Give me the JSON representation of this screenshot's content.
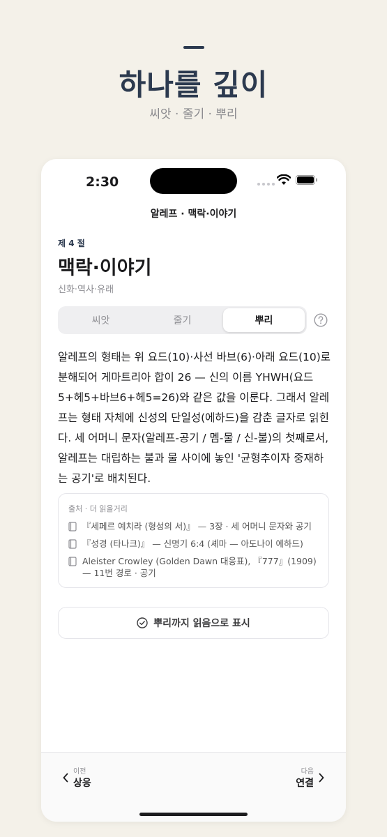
{
  "hero": {
    "title": "하나를 깊이",
    "subtitle": "씨앗 · 줄기 · 뿌리"
  },
  "status_bar": {
    "time": "2:30",
    "icons": [
      "signal-dots-icon",
      "wifi-icon",
      "battery-icon"
    ]
  },
  "nav": {
    "title": "알레프 · 맥락·이야기"
  },
  "section": {
    "label": "제 4 절",
    "title": "맥락·이야기",
    "subtitle": "신화·역사·유래"
  },
  "tabs": [
    {
      "label": "씨앗",
      "active": false
    },
    {
      "label": "줄기",
      "active": false
    },
    {
      "label": "뿌리",
      "active": true
    }
  ],
  "help_icon": "question-circle-icon",
  "body": {
    "text": "알레프의 형태는 위 요드(10)·사선 바브(6)·아래 요드(10)로 분해되어 게마트리아 합이 26 — 신의 이름 YHWH(요드5+헤5+바브6+헤5=26)와 같은 값을 이룬다. 그래서 알레프는 형태 자체에 신성의 단일성(에하드)을 감춘 글자로 읽힌다. 세 어머니 문자(알레프-공기 / 멤-물 / 신-불)의 첫째로서, 알레프는 대립하는 불과 물 사이에 놓인 '균형추이자 중재하는 공기'로 배치된다."
  },
  "sources": {
    "title": "출처 · 더 읽을거리",
    "items": [
      "『세페르 예치라 (형성의 서)』 — 3장 · 세 어머니 문자와 공기",
      "『성경 (타나크)』 — 신명기 6:4 (셰마 — 아도나이 에하드)",
      "Aleister Crowley (Golden Dawn 대응표), 『777』(1909) — 11번 경로 · 공기"
    ]
  },
  "mark_button": {
    "label": "뿌리까지 읽음으로 표시"
  },
  "bottom_nav": {
    "prev_small": "이전",
    "prev_label": "상응",
    "next_small": "다음",
    "next_label": "연결"
  },
  "colors": {
    "background": "#f4f1e9",
    "accent": "#2c3a4f",
    "card": "#ffffff"
  }
}
